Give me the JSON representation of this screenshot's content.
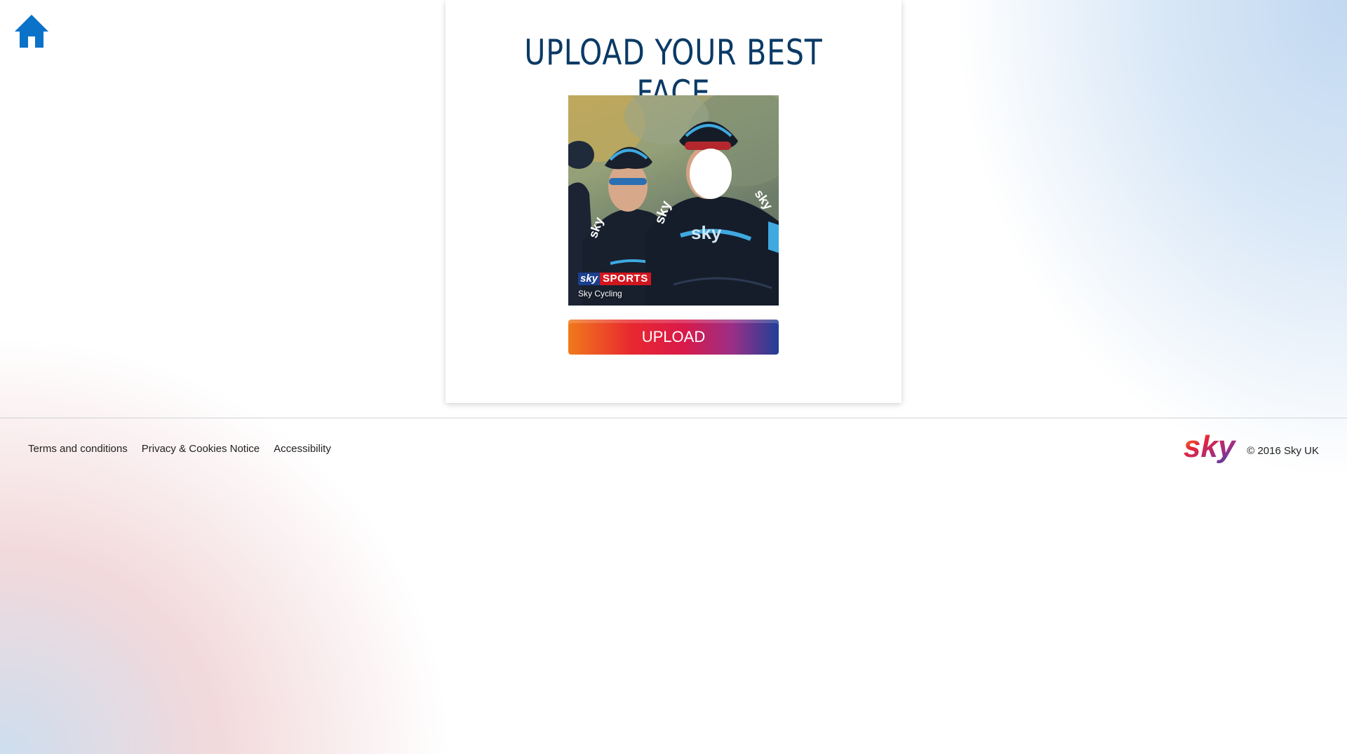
{
  "nav": {
    "home_icon": "home-icon",
    "home_color": "#0a72c9"
  },
  "card": {
    "title": "UPLOAD YOUR BEST FACE",
    "photo": {
      "badge_sky": "sky",
      "badge_sports": "SPORTS",
      "caption": "Sky Cycling"
    },
    "upload_label": "UPLOAD"
  },
  "footer": {
    "links": [
      "Terms and conditions",
      "Privacy & Cookies Notice",
      "Accessibility"
    ],
    "logo": "sky",
    "copyright": "© 2016 Sky UK"
  },
  "colors": {
    "title": "#0a3a66",
    "button_gradient": [
      "#f07a1c",
      "#e8282f",
      "#d91a4a",
      "#9a2f86",
      "#203f97"
    ]
  }
}
